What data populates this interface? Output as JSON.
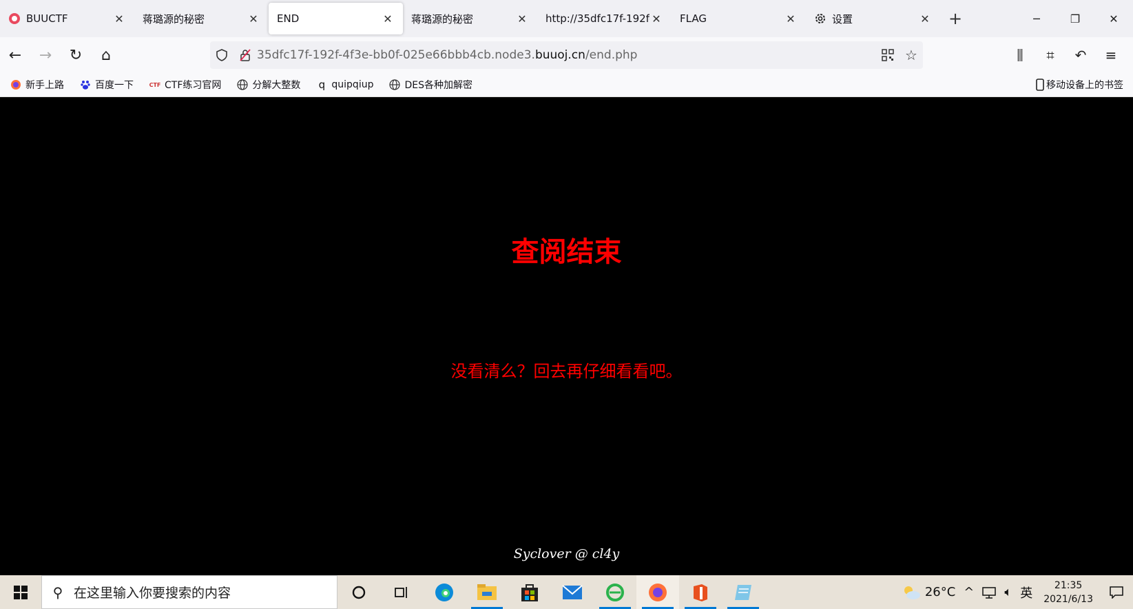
{
  "tabs": [
    {
      "label": "BUUCTF",
      "icon": "buuctf-logo-icon",
      "active": false
    },
    {
      "label": "蒋璐源的秘密",
      "icon": "",
      "active": false
    },
    {
      "label": "END",
      "icon": "",
      "active": true
    },
    {
      "label": "蒋璐源的秘密",
      "icon": "",
      "active": false
    },
    {
      "label": "http://35dfc17f-192f-",
      "icon": "",
      "active": false
    },
    {
      "label": "FLAG",
      "icon": "",
      "active": false
    },
    {
      "label": "设置",
      "icon": "gear-icon",
      "active": false
    }
  ],
  "address": {
    "prefix": "35dfc17f-192f-4f3e-bb0f-025e66bbb4cb.node3.",
    "domain": "buuoj.cn",
    "path": "/end.php"
  },
  "bookmarks": [
    {
      "label": "新手上路",
      "icon": "firefox-icon"
    },
    {
      "label": "百度一下",
      "icon": "baidu-paw-icon"
    },
    {
      "label": "CTF练习官网",
      "icon": "ctf-logo-icon"
    },
    {
      "label": "分解大整数",
      "icon": "globe-icon"
    },
    {
      "label": "quipqiup",
      "icon": "q-icon"
    },
    {
      "label": "DES各种加解密",
      "icon": "globe-icon"
    }
  ],
  "mobile_bookmarks": "移动设备上的书签",
  "page": {
    "heading": "查阅结束",
    "message": "没看清么？回去再仔细看看吧。",
    "footer": "Syclover @ cl4y",
    "accent_color": "#ff0000"
  },
  "taskbar": {
    "search_placeholder": "在这里输入你要搜索的内容",
    "weather_temp": "26°C",
    "ime": "英",
    "time": "21:35",
    "date": "2021/6/13"
  }
}
